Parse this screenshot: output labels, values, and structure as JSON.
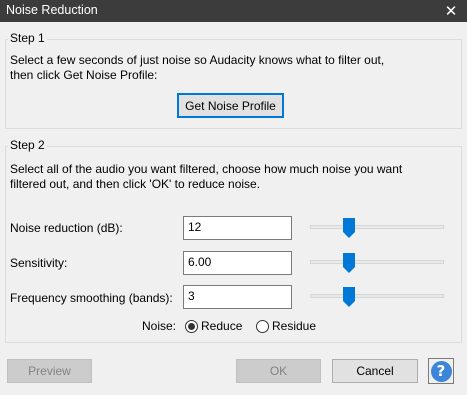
{
  "window": {
    "title": "Noise Reduction",
    "close_glyph": "✕"
  },
  "step1": {
    "label": "Step 1",
    "line1": "Select a few seconds of just noise so Audacity knows what to filter out,",
    "line2": "then click Get Noise Profile:",
    "button": "Get Noise Profile"
  },
  "step2": {
    "label": "Step 2",
    "line1": "Select all of the audio you want filtered, choose how much noise you want",
    "line2": "filtered out, and then click 'OK' to reduce noise.",
    "noise_reduction": {
      "label": "Noise reduction (dB):",
      "value": "12",
      "slider_fraction": 0.27
    },
    "sensitivity": {
      "label": "Sensitivity:",
      "value": "6.00",
      "slider_fraction": 0.27
    },
    "freq_smoothing": {
      "label": "Frequency smoothing (bands):",
      "value": "3",
      "slider_fraction": 0.27
    },
    "noise_label": "Noise:",
    "options": [
      "Reduce",
      "Residue"
    ],
    "selected": "Reduce"
  },
  "buttons": {
    "preview": "Preview",
    "ok": "OK",
    "cancel": "Cancel",
    "help": "?"
  },
  "colors": {
    "slider_thumb": "#0078d7",
    "titlebar": "#3c3c3c",
    "help_icon": "#3d85d8"
  }
}
